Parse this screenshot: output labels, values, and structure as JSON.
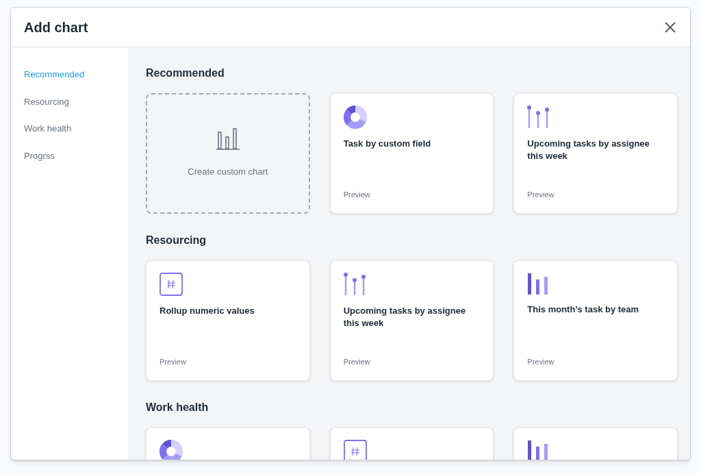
{
  "dialog": {
    "title": "Add chart"
  },
  "sidebar": {
    "items": [
      {
        "label": "Recommended",
        "selected": true
      },
      {
        "label": "Resourcing",
        "selected": false
      },
      {
        "label": "Work health",
        "selected": false
      },
      {
        "label": "Progrss",
        "selected": false
      }
    ]
  },
  "sections": [
    {
      "title": "Recommended",
      "cards": [
        {
          "kind": "custom",
          "label": "Create custom chart"
        },
        {
          "kind": "donut",
          "label": "Task by custom field",
          "footer": "Preview"
        },
        {
          "kind": "lollipop",
          "label": "Upcoming tasks by assignee this week",
          "footer": "Preview"
        }
      ]
    },
    {
      "title": "Resourcing",
      "cards": [
        {
          "kind": "hash",
          "label": "Rollup numeric values",
          "footer": "Preview"
        },
        {
          "kind": "lollipop",
          "label": "Upcoming tasks by assignee this week",
          "footer": "Preview"
        },
        {
          "kind": "bars",
          "label": "This month’s task by team",
          "footer": "Preview"
        }
      ]
    },
    {
      "title": "Work health",
      "cards": [
        {
          "kind": "donut"
        },
        {
          "kind": "hash"
        },
        {
          "kind": "bars"
        }
      ]
    }
  ]
}
